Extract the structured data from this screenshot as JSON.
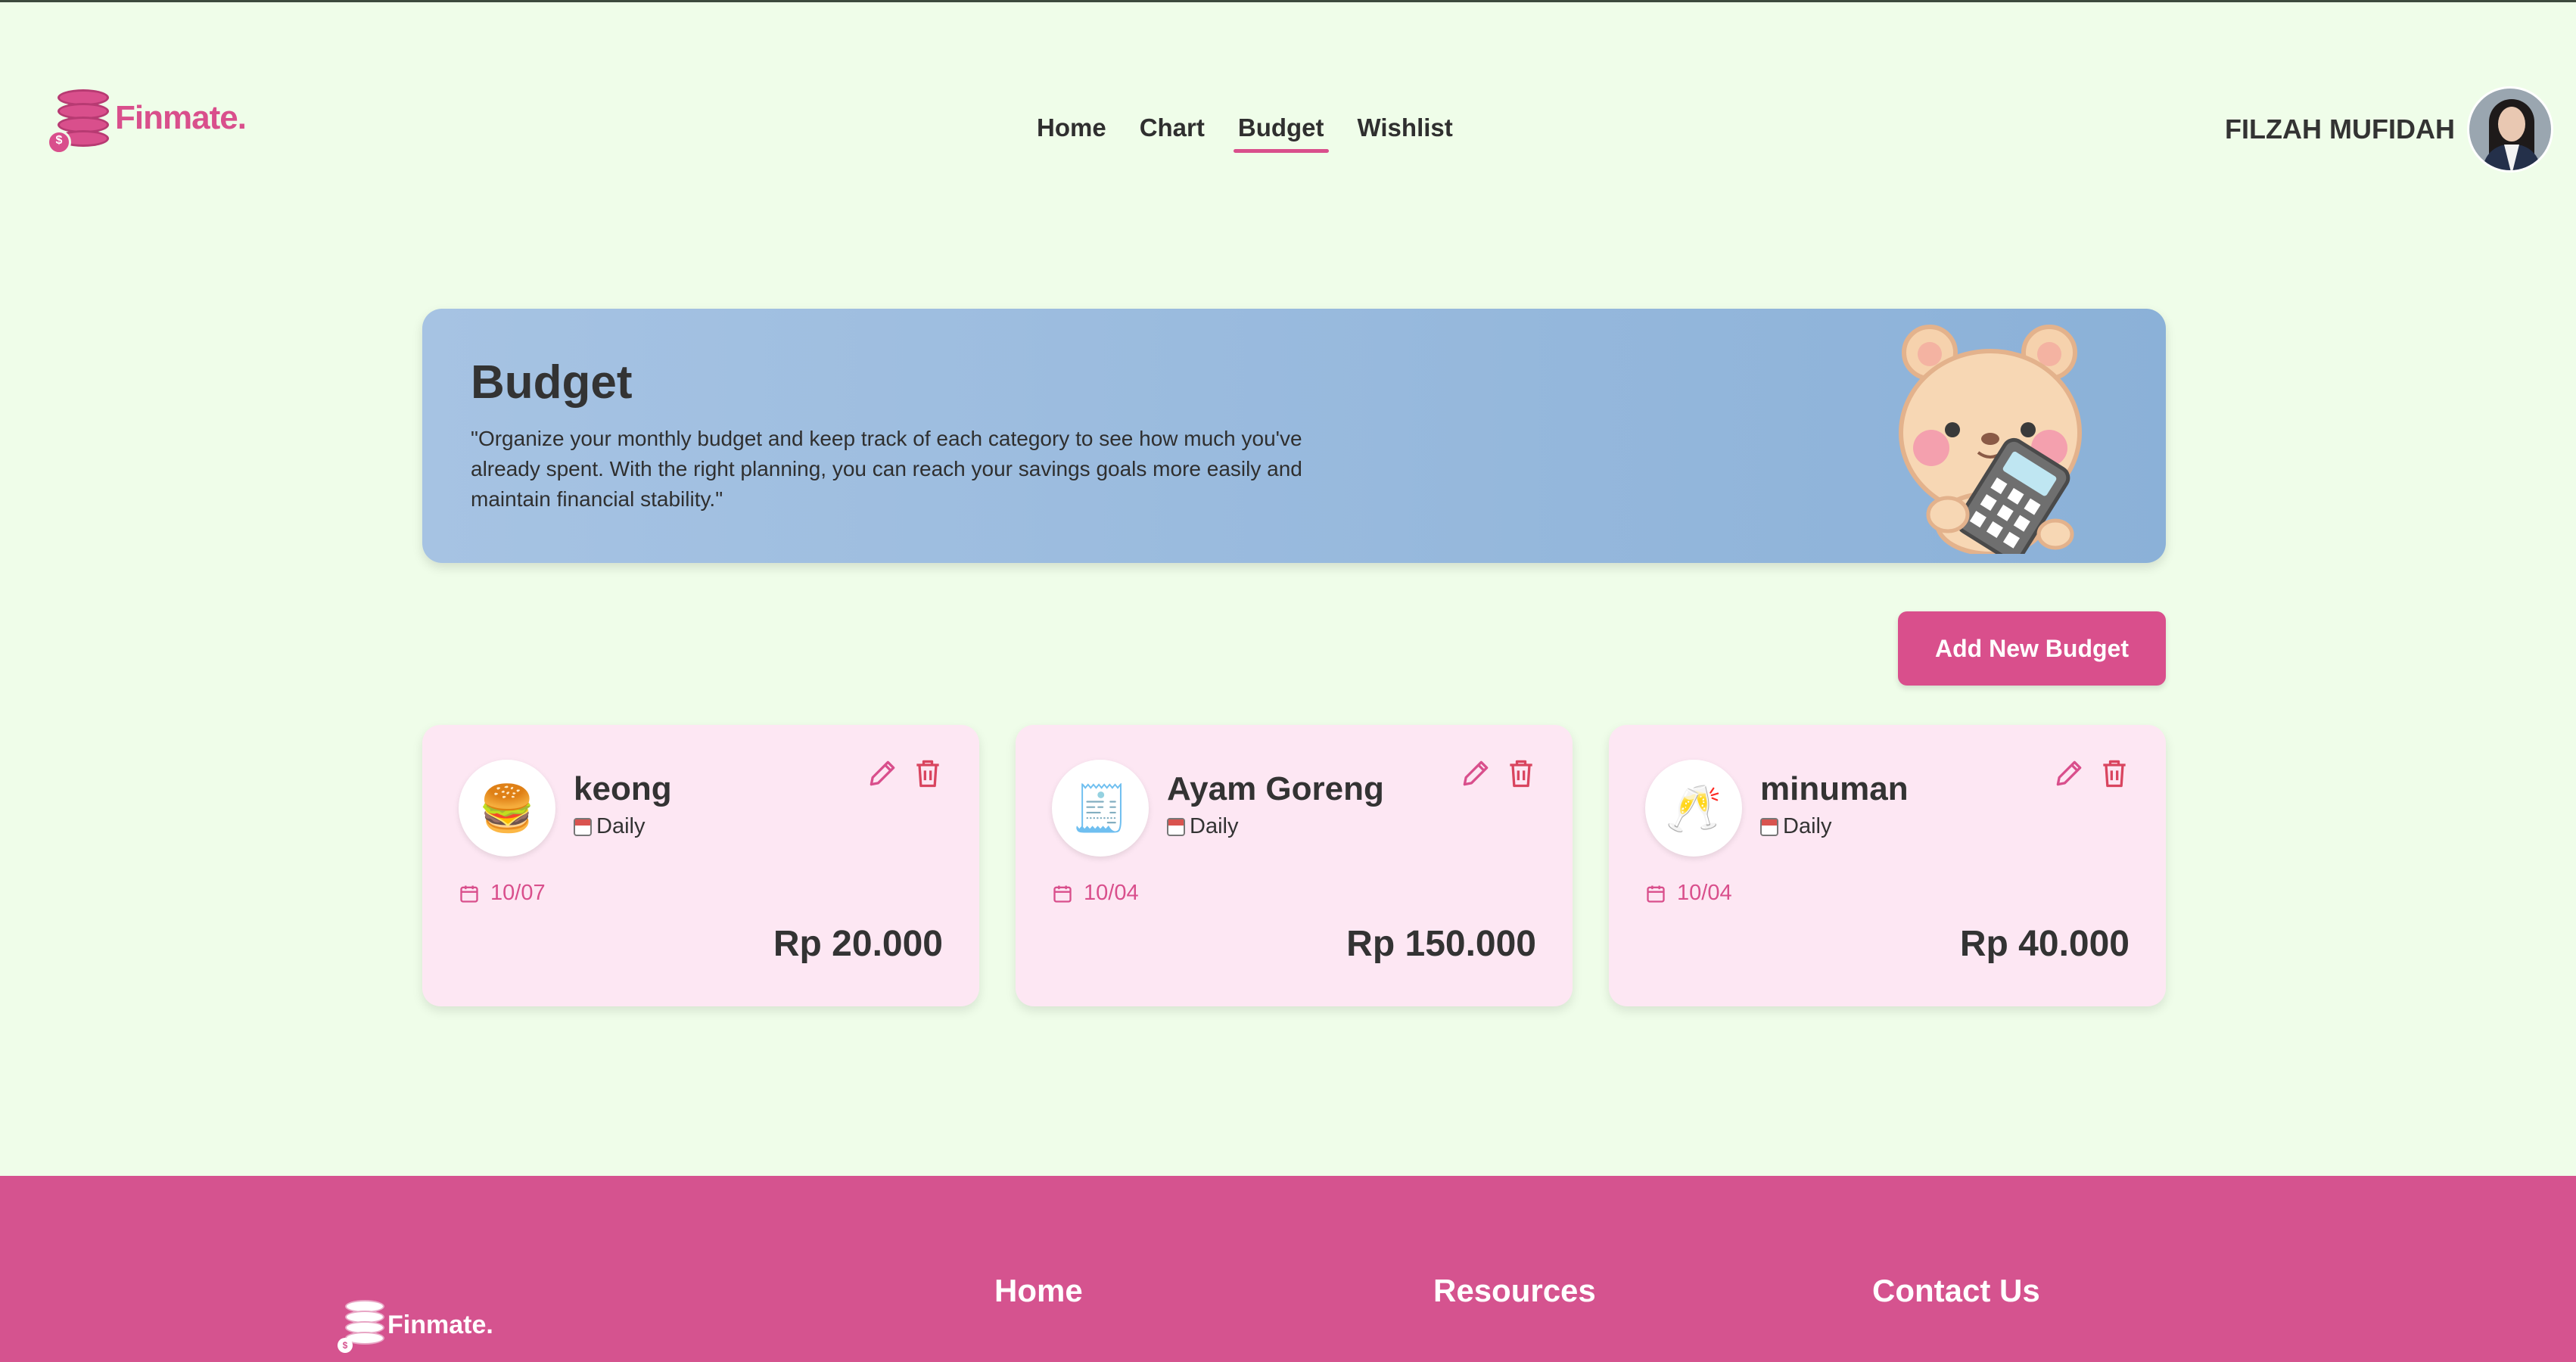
{
  "brand": {
    "name": "Finmate.",
    "badge": "$",
    "color": "#d94f8c"
  },
  "nav": {
    "items": [
      {
        "label": "Home",
        "active": false
      },
      {
        "label": "Chart",
        "active": false
      },
      {
        "label": "Budget",
        "active": true
      },
      {
        "label": "Wishlist",
        "active": false
      }
    ]
  },
  "user": {
    "name": "FILZAH MUFIDAH",
    "avatar_icon": "user-avatar"
  },
  "hero": {
    "title": "Budget",
    "description": "\"Organize your monthly budget and keep track of each category to see how much you've already spent. With the right planning, you can reach your savings goals more easily and maintain financial stability.\"",
    "illustration": "bear-with-calculator"
  },
  "actions": {
    "add_label": "Add New Budget"
  },
  "budgets": [
    {
      "title": "keong",
      "icon": "🍔",
      "frequency": "Daily",
      "date": "10/07",
      "amount": "Rp 20.000"
    },
    {
      "title": "Ayam Goreng",
      "icon": "🧾",
      "frequency": "Daily",
      "date": "10/04",
      "amount": "Rp 150.000"
    },
    {
      "title": "minuman",
      "icon": "🥂",
      "frequency": "Daily",
      "date": "10/04",
      "amount": "Rp 40.000"
    }
  ],
  "footer": {
    "brand": "Finmate.",
    "columns": [
      "Home",
      "Resources",
      "Contact Us"
    ]
  },
  "colors": {
    "accent": "#d94f8c",
    "background": "#effde9",
    "hero": "#9bbbe0",
    "card": "#fde7f3",
    "footer": "#d5538f"
  }
}
